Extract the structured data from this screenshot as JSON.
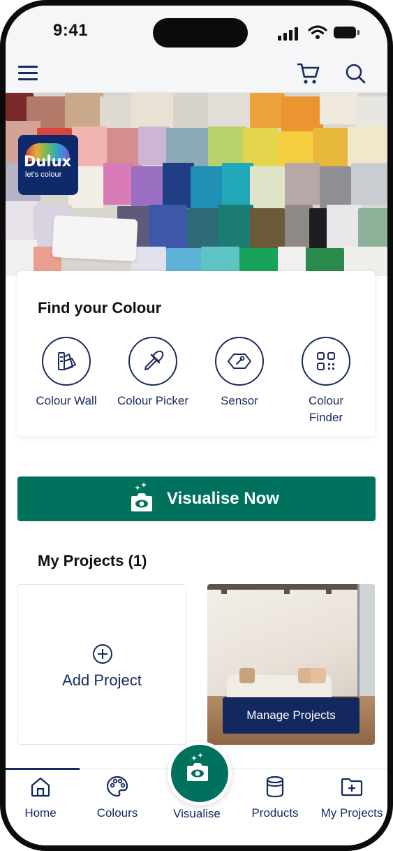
{
  "status_bar": {
    "time": "9:41"
  },
  "brand": {
    "name": "Dulux",
    "tagline": "let's colour"
  },
  "find_colour": {
    "title": "Find your Colour",
    "tools": [
      {
        "label": "Colour Wall",
        "icon": "swatch-fan-icon"
      },
      {
        "label": "Colour Picker",
        "icon": "eyedropper-icon"
      },
      {
        "label": "Sensor",
        "icon": "sensor-icon"
      },
      {
        "label": "Colour Finder",
        "icon": "qr-code-icon"
      }
    ]
  },
  "visualise_button": {
    "label": "Visualise Now",
    "icon": "camera-sparkle-icon"
  },
  "projects": {
    "title": "My Projects (1)",
    "add_label": "Add Project",
    "manage_label": "Manage Projects"
  },
  "bottom_nav": {
    "items": [
      {
        "label": "Home",
        "icon": "home-icon",
        "active": true
      },
      {
        "label": "Colours",
        "icon": "palette-icon"
      },
      {
        "label": "Visualise",
        "icon": "camera-sparkle-icon"
      },
      {
        "label": "Products",
        "icon": "paint-can-icon"
      },
      {
        "label": "My Projects",
        "icon": "folder-plus-icon"
      }
    ]
  },
  "colors": {
    "navy": "#13285f",
    "green": "#00715c"
  }
}
